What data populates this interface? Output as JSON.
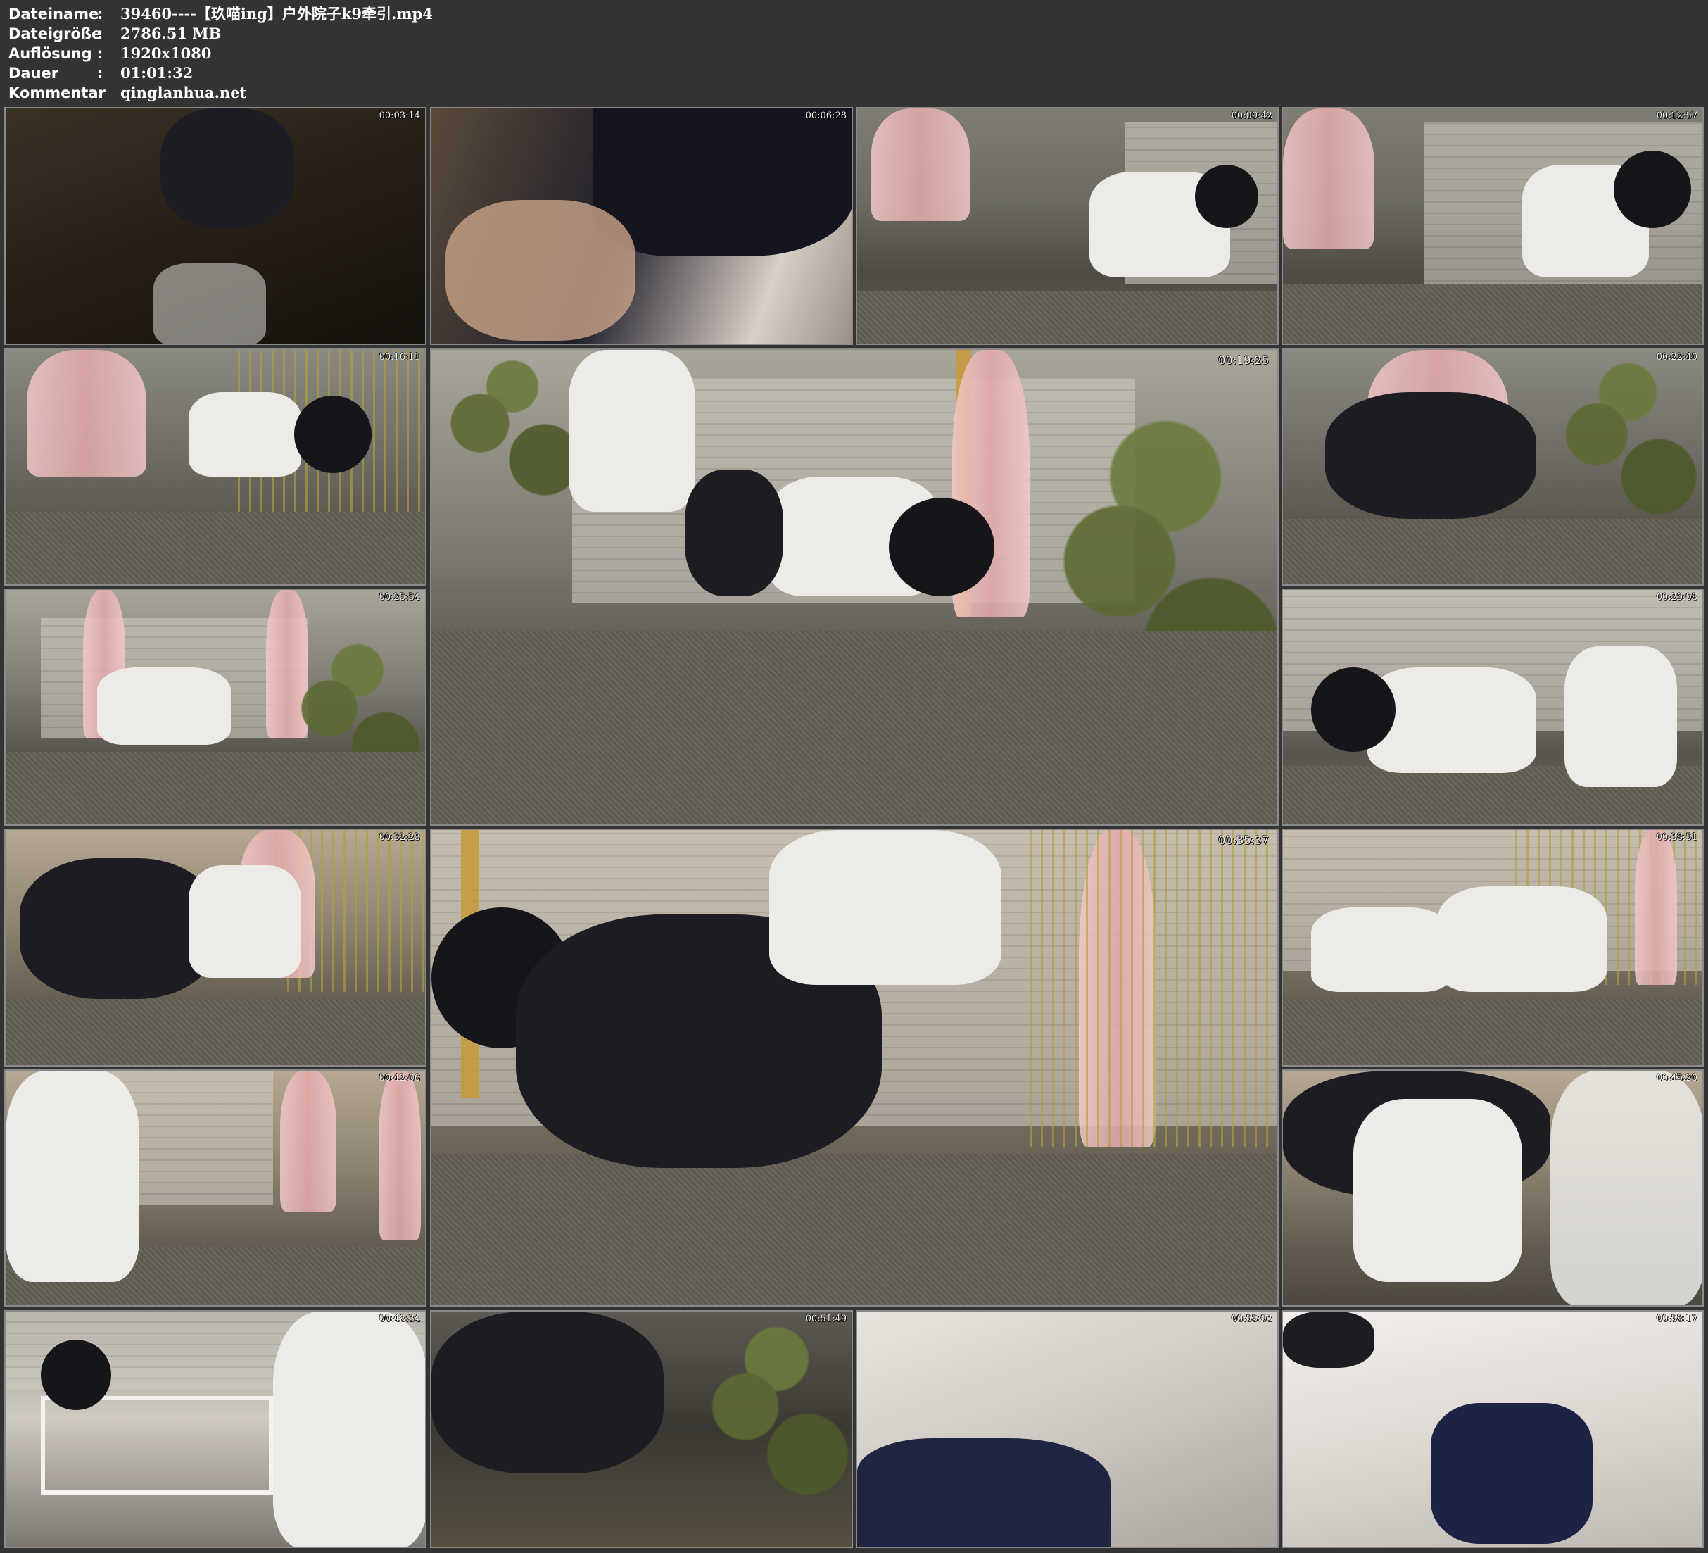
{
  "header": {
    "rows": [
      {
        "label": "Dateiname",
        "sep": ":",
        "value": "39460----【玖喵ing】户外院子k9牵引.mp4"
      },
      {
        "label": "Dateigröße",
        "sep": ":",
        "value": "2786.51 MB"
      },
      {
        "label": "Auflösung",
        "sep": ":",
        "value": "1920x1080"
      },
      {
        "label": "Dauer",
        "sep": ":",
        "value": "01:01:32"
      },
      {
        "label": "Kommentar",
        "sep": ":",
        "value": "qinglanhua.net"
      }
    ]
  },
  "thumbnails": [
    {
      "timestamp": "00:03:14"
    },
    {
      "timestamp": "00:06:28"
    },
    {
      "timestamp": "00:09:42"
    },
    {
      "timestamp": "00:12:57"
    },
    {
      "timestamp": "00:16:11"
    },
    {
      "timestamp": "00:19:25"
    },
    {
      "timestamp": "00:22:40"
    },
    {
      "timestamp": "00:25:54"
    },
    {
      "timestamp": "00:29:08"
    },
    {
      "timestamp": "00:32:23"
    },
    {
      "timestamp": "00:35:37"
    },
    {
      "timestamp": "00:38:51"
    },
    {
      "timestamp": "00:42:06"
    },
    {
      "timestamp": "00:45:20"
    },
    {
      "timestamp": "00:48:34"
    },
    {
      "timestamp": "00:51:49"
    },
    {
      "timestamp": "00:55:03"
    },
    {
      "timestamp": "00:58:17"
    }
  ]
}
